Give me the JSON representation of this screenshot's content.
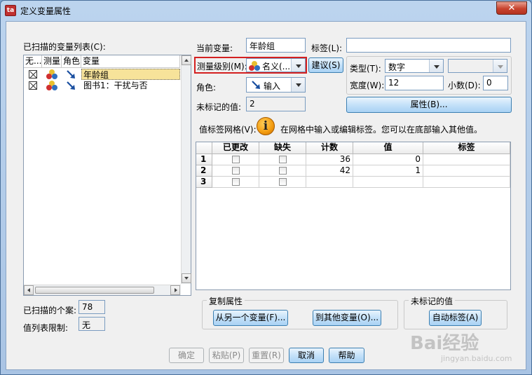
{
  "window": {
    "title": "定义变量属性",
    "close_glyph": "✕",
    "app_icon_glyph": "ta"
  },
  "left": {
    "scanned_list_label": "已扫描的变量列表(C):",
    "columns": [
      "无...",
      "测量",
      "角色",
      "变量"
    ],
    "rows": [
      {
        "name": "年龄组",
        "measure_icon": "nominal-balls-icon",
        "role_icon": "input-arrow-icon",
        "selected": true
      },
      {
        "name": "图书1：干扰与否",
        "measure_icon": "nominal-balls-icon",
        "role_icon": "input-arrow-icon",
        "selected": false
      }
    ],
    "cases_label": "已扫描的个案:",
    "cases_value": "78",
    "value_list_limit_label": "值列表限制:",
    "value_list_limit_value": "无"
  },
  "right": {
    "current_var_label": "当前变量:",
    "current_var_value": "年龄组",
    "label_label": "标签(L):",
    "label_value": "",
    "measure_label": "测量级别(M):",
    "measure_value": "名义(...",
    "suggest_button": "建议(S)",
    "type_label": "类型(T):",
    "type_value": "数字",
    "type_extra_value": "",
    "role_label": "角色:",
    "role_value": "输入",
    "width_label": "宽度(W):",
    "width_value": "12",
    "decimals_label": "小数(D):",
    "decimals_value": "0",
    "unlabeled_label": "未标记的值:",
    "unlabeled_value": "2",
    "attributes_button": "属性(B)...",
    "grid_label": "值标签网格(V):",
    "info_text": "在网格中输入或编辑标签。您可以在底部输入其他值。",
    "info_glyph": "i"
  },
  "grid": {
    "headers": [
      "",
      "已更改",
      "缺失",
      "计数",
      "值",
      "标签"
    ],
    "rows": [
      {
        "num": "1",
        "changed": false,
        "missing": false,
        "count": "36",
        "value": "0",
        "label": ""
      },
      {
        "num": "2",
        "changed": false,
        "missing": false,
        "count": "42",
        "value": "1",
        "label": ""
      },
      {
        "num": "3",
        "changed": false,
        "missing": false,
        "count": "",
        "value": "",
        "label": ""
      }
    ]
  },
  "copy_group": {
    "legend": "复制属性",
    "from_button": "从另一个变量(F)...",
    "to_button": "到其他变量(O)..."
  },
  "unlabeled_group": {
    "legend": "未标记的值",
    "auto_button": "自动标签(A)"
  },
  "footer": {
    "ok": "确定",
    "paste": "粘贴(P)",
    "reset": "重置(R)",
    "cancel": "取消",
    "help": "帮助"
  },
  "watermark": {
    "brand": "Bai经验",
    "url": "jingyan.baidu.com"
  },
  "colors": {
    "selected_row": "#f7e39a",
    "highlight_box": "#d42020",
    "accent_blue": "#3c7fb1"
  }
}
